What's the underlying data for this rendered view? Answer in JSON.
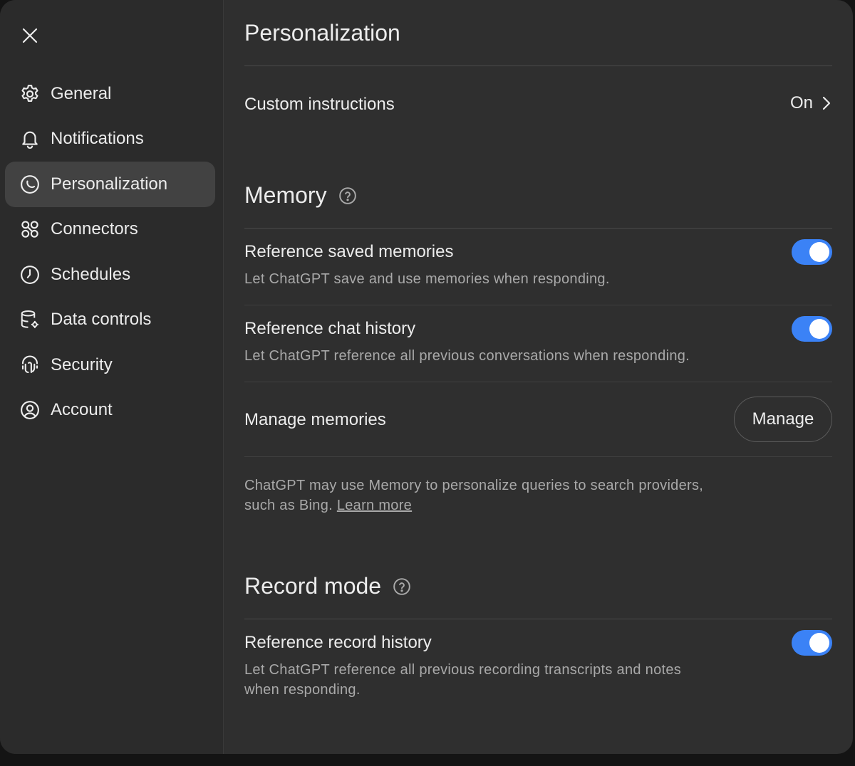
{
  "sidebar": {
    "items": [
      {
        "label": "General",
        "icon": "gear-icon"
      },
      {
        "label": "Notifications",
        "icon": "bell-icon"
      },
      {
        "label": "Personalization",
        "icon": "personalization-icon",
        "active": true
      },
      {
        "label": "Connectors",
        "icon": "connectors-icon"
      },
      {
        "label": "Schedules",
        "icon": "clock-icon"
      },
      {
        "label": "Data controls",
        "icon": "database-icon"
      },
      {
        "label": "Security",
        "icon": "security-icon"
      },
      {
        "label": "Account",
        "icon": "account-icon"
      }
    ]
  },
  "main": {
    "title": "Personalization",
    "custom_instructions": {
      "label": "Custom instructions",
      "value": "On"
    },
    "memory": {
      "title": "Memory",
      "reference_saved": {
        "label": "Reference saved memories",
        "description": "Let ChatGPT save and use memories when responding.",
        "enabled": true
      },
      "reference_chat": {
        "label": "Reference chat history",
        "description": "Let ChatGPT reference all previous conversations when responding.",
        "enabled": true
      },
      "manage": {
        "label": "Manage memories",
        "button": "Manage"
      },
      "note_line1": "ChatGPT may use Memory to personalize queries to search providers,",
      "note_line2": "such as Bing.",
      "learn_more": "Learn more"
    },
    "record_mode": {
      "title": "Record mode",
      "reference_record": {
        "label": "Reference record history",
        "description_line1": "Let ChatGPT reference all previous recording transcripts and notes",
        "description_line2": "when responding.",
        "enabled": true
      }
    }
  },
  "colors": {
    "accent": "#3b82f6",
    "background": "#2f2f2f",
    "sidebar": "#2b2b2b",
    "active_item": "#424242"
  }
}
